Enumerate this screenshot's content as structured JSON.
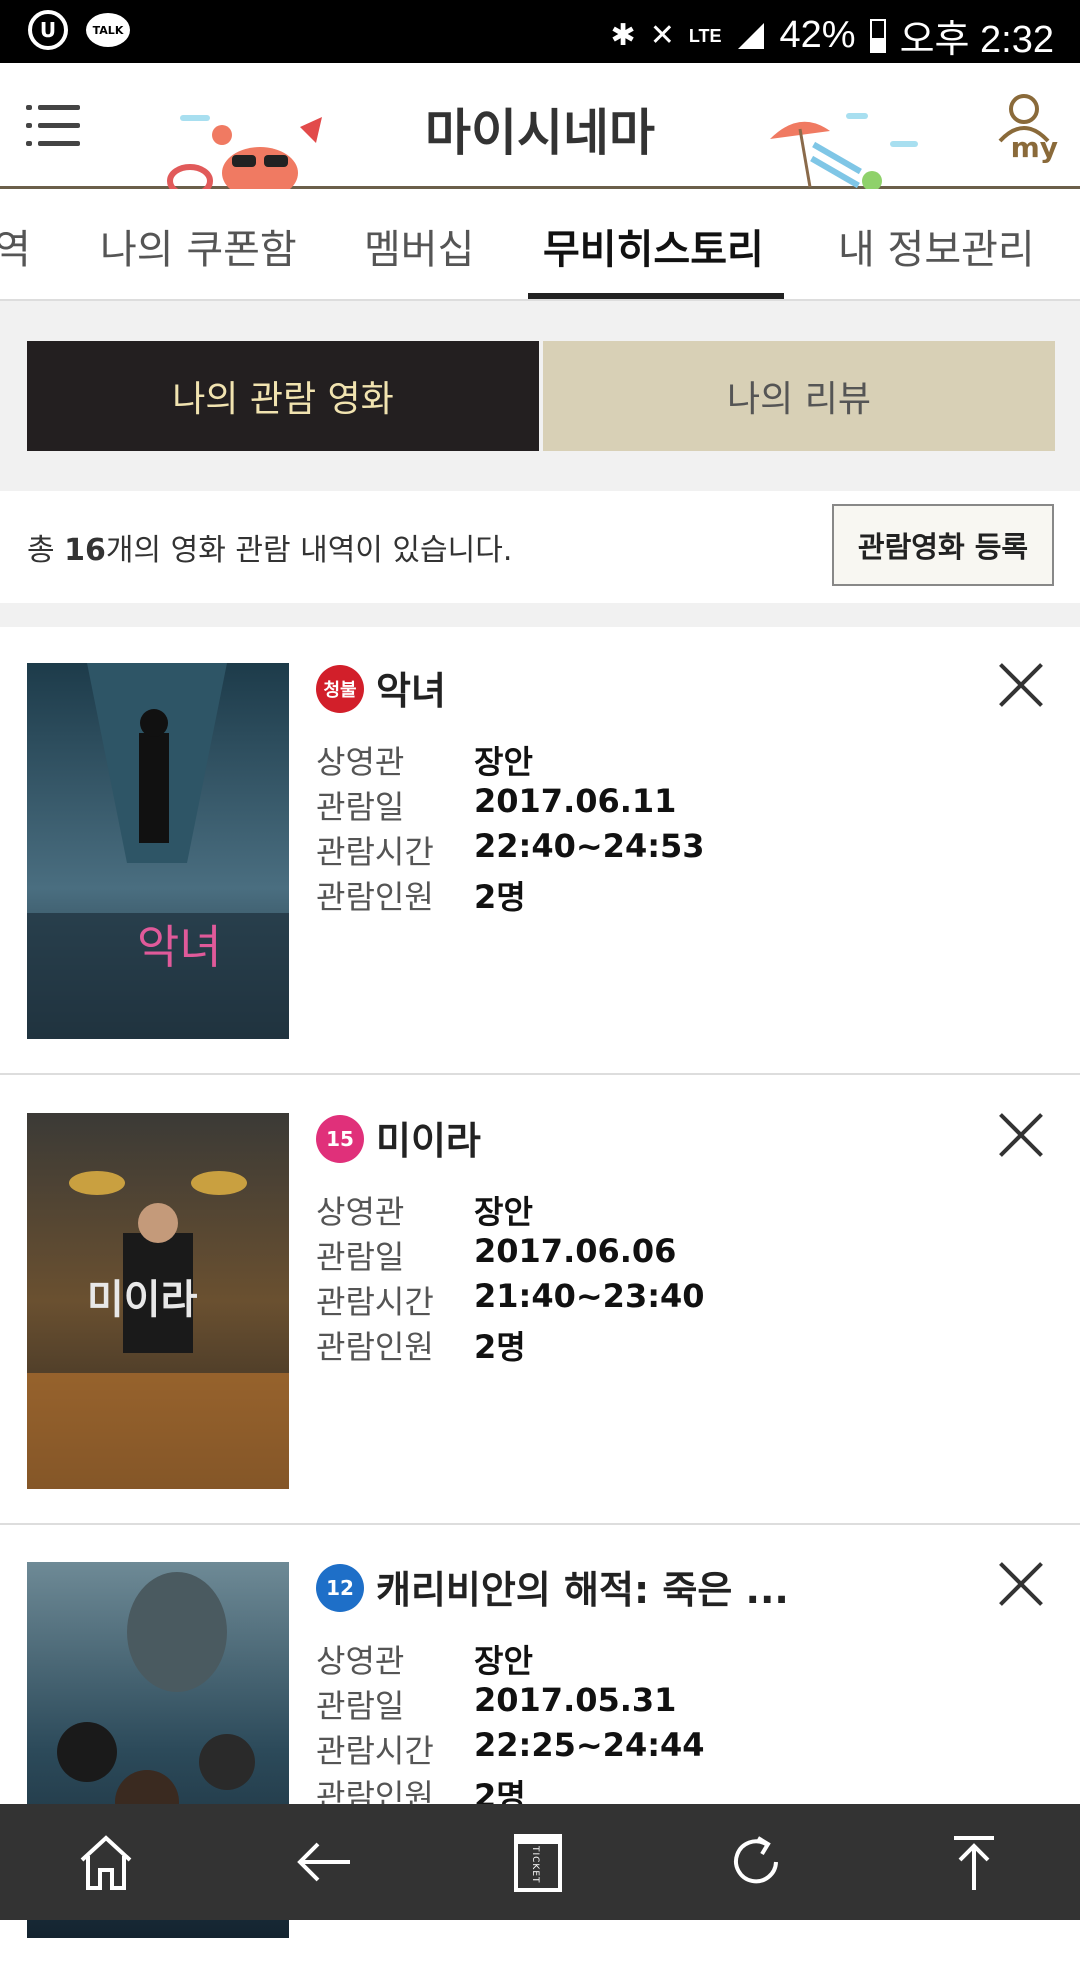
{
  "status_bar": {
    "left_icons": [
      "u-plus-icon",
      "kakaotalk-icon"
    ],
    "talk_label": "TALK",
    "u_label": "U",
    "network": "LTE",
    "battery": "42%",
    "time": "오후 2:32"
  },
  "header": {
    "title": "마이시네마",
    "my_label": "my"
  },
  "tabs": [
    {
      "label": "역",
      "active": false
    },
    {
      "label": "나의 쿠폰함",
      "active": false
    },
    {
      "label": "멤버십",
      "active": false
    },
    {
      "label": "무비히스토리",
      "active": true
    },
    {
      "label": "내 정보관리",
      "active": false
    }
  ],
  "segments": {
    "watched": "나의 관람 영화",
    "reviews": "나의 리뷰"
  },
  "summary": {
    "prefix": "총 ",
    "count": "16",
    "suffix": "개의 영화 관람 내역이 있습니다.",
    "register_button": "관람영화 등록"
  },
  "labels": {
    "theater": "상영관",
    "date": "관람일",
    "time": "관람시간",
    "people": "관람인원"
  },
  "movies": [
    {
      "title": "악녀",
      "rating": "청불",
      "rating_color": "#d21f2a",
      "theater": "장안",
      "date": "2017.06.11",
      "time": "22:40~24:53",
      "people": "2명"
    },
    {
      "title": "미이라",
      "rating": "15",
      "rating_color": "#e0307a",
      "theater": "장안",
      "date": "2017.06.06",
      "time": "21:40~23:40",
      "people": "2명"
    },
    {
      "title": "캐리비안의 해적: 죽은 ...",
      "rating": "12",
      "rating_color": "#1e6fc8",
      "theater": "장안",
      "date": "2017.05.31",
      "time": "22:25~24:44",
      "people": "2명"
    }
  ],
  "colors": {
    "header_rule": "#6b5f4a",
    "segment_active_bg": "#231f20",
    "segment_active_text": "#f1e3b0",
    "segment_inactive_bg": "#d8d0b6",
    "bottom_nav_bg": "#333333"
  },
  "bottom_nav": [
    "home-icon",
    "back-arrow-icon",
    "ticket-icon",
    "refresh-icon",
    "scroll-top-icon"
  ],
  "ticket_label": "TICKET"
}
